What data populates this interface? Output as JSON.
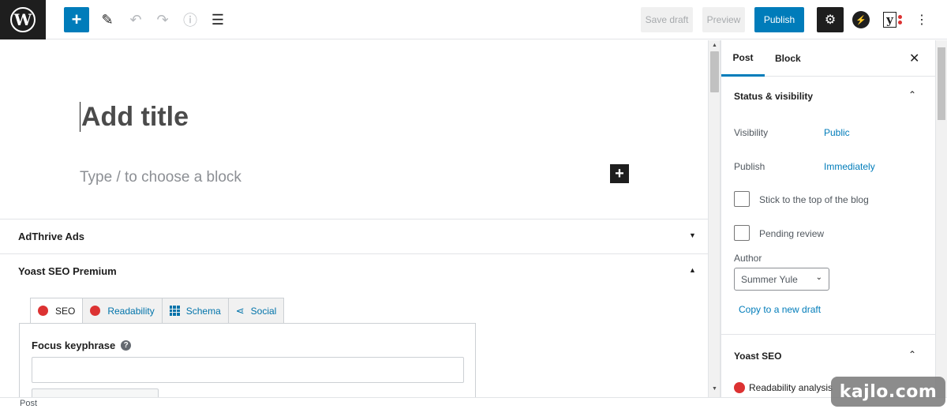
{
  "toolbar": {
    "logo": "W",
    "inserter_icon": "+",
    "tools_icon": "✎",
    "undo_icon": "↶",
    "redo_icon": "↷",
    "info_icon": "ⓘ",
    "outline_icon": "☰",
    "save_draft": "Save draft",
    "preview": "Preview",
    "publish": "Publish",
    "settings_icon": "⚙",
    "jetpack_icon": "⚡",
    "yoast_icon": "y",
    "more_icon": "⋮"
  },
  "editor": {
    "title_placeholder": "Add title",
    "block_prompt": "Type / to choose a block",
    "block_add_icon": "+"
  },
  "metaboxes": {
    "adthrive": {
      "title": "AdThrive Ads",
      "arrow": "▼"
    },
    "yoast": {
      "title": "Yoast SEO Premium",
      "arrow": "▲",
      "tabs": [
        "SEO",
        "Readability",
        "Schema",
        "Social"
      ],
      "focus_keyphrase_label": "Focus keyphrase",
      "help_icon": "?"
    }
  },
  "scrollbar": {
    "up": "▲",
    "down": "▼"
  },
  "sidebar": {
    "tabs": {
      "post": "Post",
      "block": "Block"
    },
    "close_icon": "✕",
    "status_visibility": {
      "title": "Status & visibility",
      "arrow": "⌃",
      "visibility_label": "Visibility",
      "visibility_value": "Public",
      "publish_label": "Publish",
      "publish_value": "Immediately",
      "sticky_label": "Stick to the top of the blog",
      "pending_label": "Pending review",
      "author_label": "Author",
      "author_value": "Summer Yule",
      "author_chevron": "⌄",
      "copy_draft": "Copy to a new draft"
    },
    "yoast_seo": {
      "title": "Yoast SEO",
      "arrow": "⌃",
      "readability": "Readability analysis"
    }
  },
  "footer": {
    "breadcrumb": "Post"
  },
  "watermark": "kajlo.com",
  "colors": {
    "accent": "#007cba",
    "dark": "#1e1e1e",
    "error": "#dc3232"
  }
}
